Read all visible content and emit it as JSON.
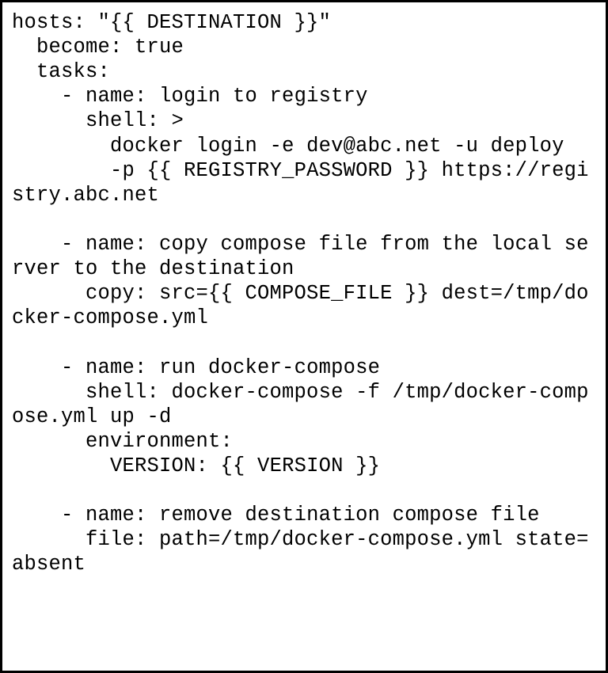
{
  "code": "hosts: \"{{ DESTINATION }}\"\n  become: true\n  tasks:\n    - name: login to registry\n      shell: >\n        docker login -e dev@abc.net -u deploy\n        -p {{ REGISTRY_PASSWORD }} https://registry.abc.net\n\n    - name: copy compose file from the local server to the destination\n      copy: src={{ COMPOSE_FILE }} dest=/tmp/docker-compose.yml\n\n    - name: run docker-compose\n      shell: docker-compose -f /tmp/docker-compose.yml up -d\n      environment:\n        VERSION: {{ VERSION }}\n\n    - name: remove destination compose file\n      file: path=/tmp/docker-compose.yml state=absent"
}
